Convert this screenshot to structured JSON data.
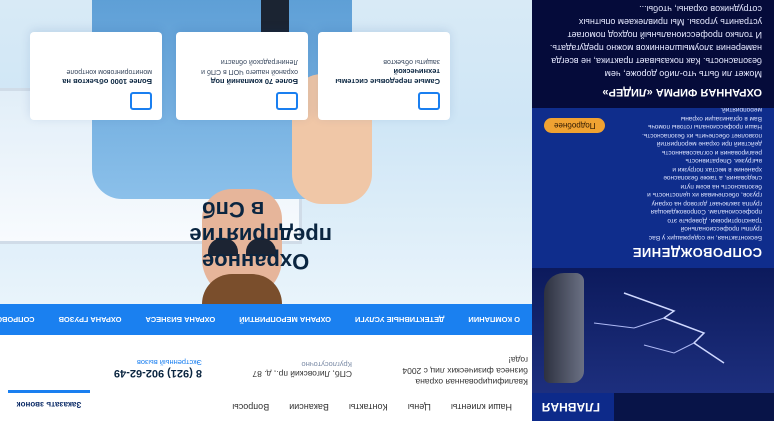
{
  "left_panel": {
    "nav": {
      "home_label": "ГЛАВНАЯ"
    },
    "escort": {
      "title": "СОПРОВОЖДЕНИЕ",
      "body": "Бесконтактная, не содержащих у Вас группы профессиональной транспортировки. Доверьте это профессионалам. Сопровождающая группа заключает договор на охрану грузов, обеспечивая их целостность и безопасность на всем пути следования, а также безопасное хранение в местах погрузки и выгрузки. Оперативность реагирования и согласованность действий при охране мероприятий позволяет обеспечить их безопасность. Наши профессионалы готовы помочь Вам в организации охраны мероприятий.",
      "more_label": "Подробнее"
    },
    "lider": {
      "title": "ОХРАННАЯ ФИРМА «ЛИДЕР»",
      "body": "Может ли быть что-либо дороже, чем безопасность. Как показывает практика, не всегда намерения злоумышленников можно предугадать. И только профессиональный подход помогает устранить угрозы. Мы привлекаем опытных сотрудников охраны, чтобы..."
    }
  },
  "header": {
    "menu": [
      "Наши клиенты",
      "Цены",
      "Контакты",
      "Вакансии",
      "Вопросы"
    ],
    "call_button": "Заказать звонок"
  },
  "contacts": {
    "about": "Квалифицированная охрана бизнеса физических лиц с 2004 года!",
    "address_title": "СПб, Лиговский пр., д. 87",
    "address_sub": "Круглосуточно",
    "phone": "8 (921) 902-62-49",
    "phone_sub": "Экстренный вызов"
  },
  "blue_nav": [
    "О КОМПАНИИ",
    "ДЕТЕКТИВНЫЕ УСЛУГИ",
    "ОХРАНА МЕРОПРИЯТИЙ",
    "ОХРАНА БИЗНЕСА",
    "ОХРАНА ГРУЗОВ",
    "СОПРОВОЖДЕНИЕ ГРУЗОВ"
  ],
  "hero": {
    "heading": "Охранное предприятие в Спб"
  },
  "cards": [
    {
      "icon": "camera-icon",
      "title": "Более 1000 объектов на",
      "desc": "мониторинговом контроле"
    },
    {
      "icon": "location-pin-icon",
      "title": "Более 70 компаний под",
      "desc": "охраной нашего ЧОП в СПб и Ленинградской области"
    },
    {
      "icon": "cctv-icon",
      "title": "Самые передовые системы технической",
      "desc": "защиты объектов"
    }
  ]
}
